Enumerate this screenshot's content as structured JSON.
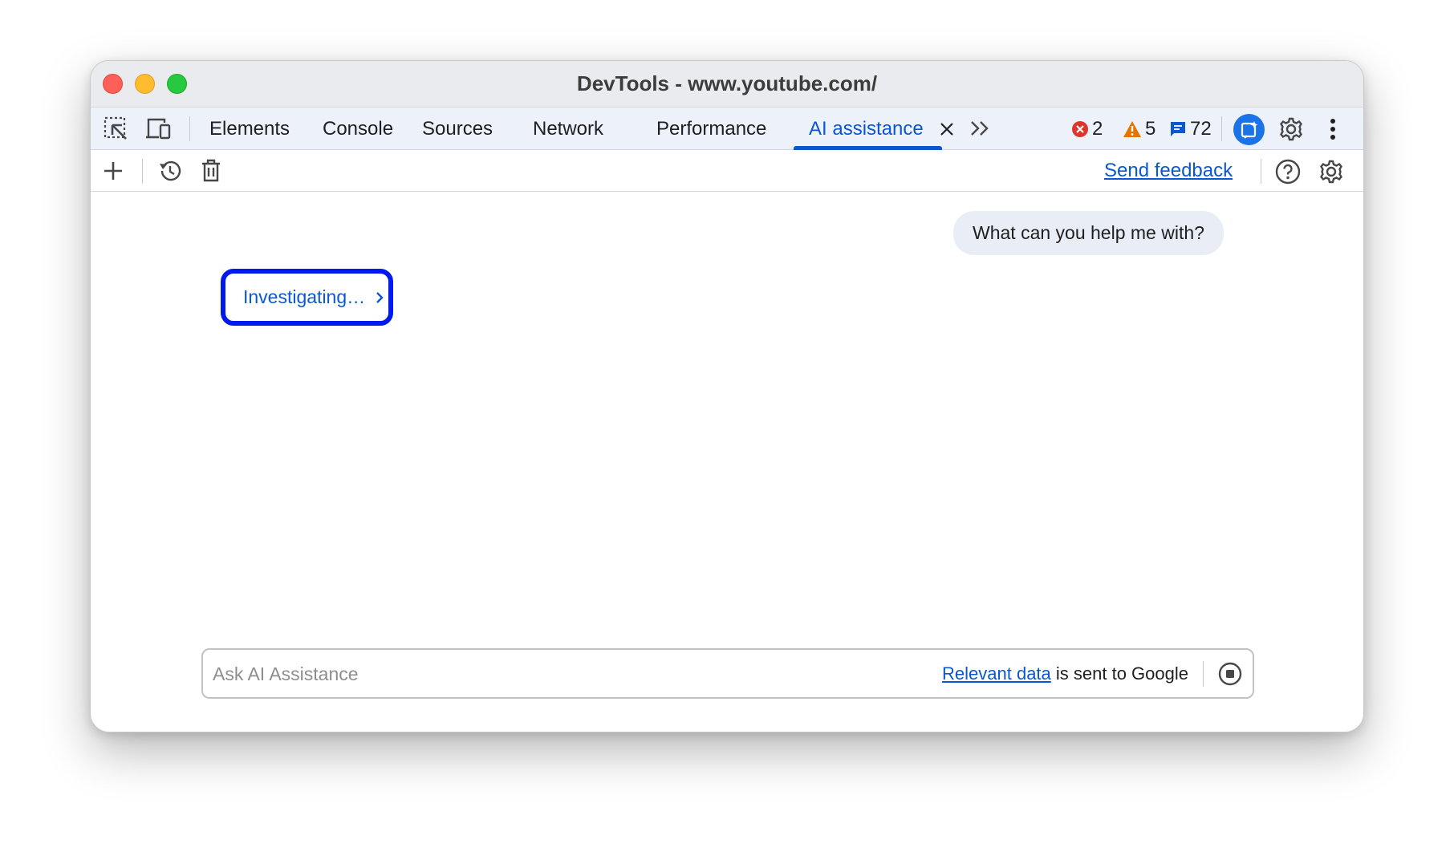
{
  "window": {
    "title": "DevTools - www.youtube.com/"
  },
  "tabs": [
    {
      "label": "Elements"
    },
    {
      "label": "Console"
    },
    {
      "label": "Sources"
    },
    {
      "label": "Network"
    },
    {
      "label": "Performance"
    },
    {
      "label": "AI assistance",
      "active": true
    }
  ],
  "counters": {
    "errors": "2",
    "warnings": "5",
    "messages": "72"
  },
  "subtoolbar": {
    "feedback_label": "Send feedback"
  },
  "chat": {
    "user_message": "What can you help me with?",
    "status_label": "Investigating…"
  },
  "input": {
    "placeholder": "Ask AI Assistance",
    "disclaimer_link": "Relevant data",
    "disclaimer_text": " is sent to Google"
  },
  "colors": {
    "accent": "#0b57d0",
    "error": "#dc362e",
    "warning": "#e37400",
    "highlight_border": "#0019ef"
  }
}
